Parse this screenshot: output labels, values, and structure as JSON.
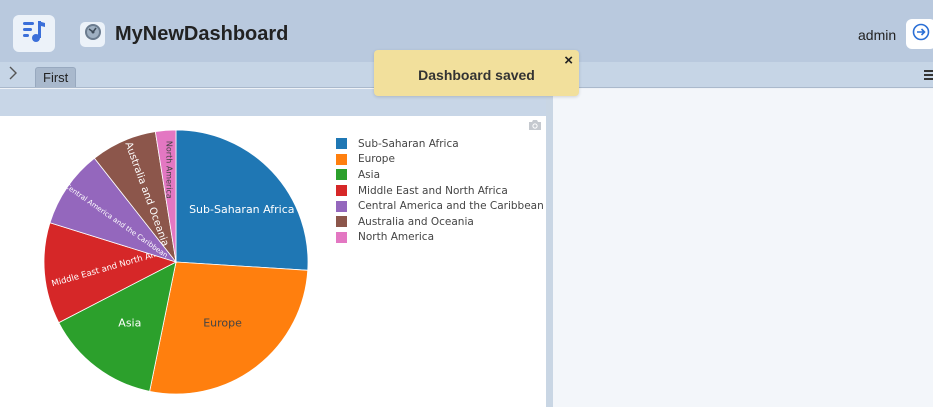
{
  "header": {
    "title": "MyNewDashboard",
    "user": "admin",
    "logo_icon": "music-note-icon",
    "globe_icon": "globe-icon",
    "logout_icon": "logout-icon"
  },
  "tabs": [
    {
      "label": "First",
      "active": true
    }
  ],
  "toast": {
    "message": "Dashboard saved",
    "close": "×"
  },
  "chart_data": {
    "type": "pie",
    "categories": [
      "Sub-Saharan Africa",
      "Europe",
      "Asia",
      "Middle East and North Africa",
      "Central America and the Caribbean",
      "Australia and Oceania",
      "North America"
    ],
    "slice_labels": [
      "Sub-Saharan Africa",
      "Europe",
      "Asia",
      "Middle East and North Africa",
      "Central America and the Caribbean",
      "Australia and Oceania",
      "North America"
    ],
    "values": [
      26.0,
      27.2,
      14.2,
      12.4,
      9.6,
      8.1,
      2.5
    ],
    "colors": [
      "#1f77b4",
      "#ff7f0e",
      "#2ca02c",
      "#d62728",
      "#9467bd",
      "#8c564b",
      "#e377c2"
    ],
    "label_colors": [
      "#ffffff",
      "#444444",
      "#ffffff",
      "#ffffff",
      "#ffffff",
      "#ffffff",
      "#444444"
    ],
    "legend_position": "right",
    "title": ""
  }
}
